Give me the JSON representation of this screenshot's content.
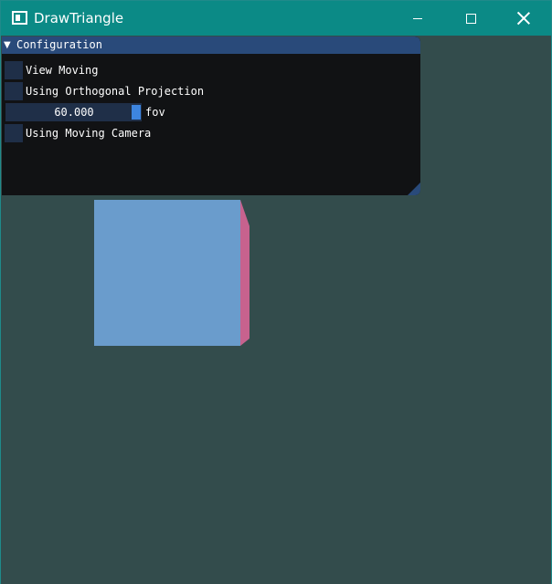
{
  "window": {
    "title": "DrawTriangle",
    "icon": "app-window-icon",
    "controls": [
      "minimize-icon",
      "maximize-icon",
      "close-icon"
    ]
  },
  "panel": {
    "title": "Configuration",
    "collapse_icon": "▼",
    "options": {
      "view_moving": {
        "label": "View Moving",
        "checked": false
      },
      "orthogonal": {
        "label": "Using Orthogonal Projection",
        "checked": false
      },
      "fov": {
        "value": "60.000",
        "label": "fov"
      },
      "moving_camera": {
        "label": "Using Moving Camera",
        "checked": false
      }
    }
  },
  "scene": {
    "clear_color": "#334c4c",
    "cube_front_color": "#6a9ccc",
    "cube_side_color": "#c7628e"
  },
  "colors": {
    "titlebar": "#0b8a86",
    "panel_header": "#294a7a",
    "panel_bg": "#111214",
    "widget_bg": "#1f2f48",
    "slider_grab": "#3d85e0"
  }
}
